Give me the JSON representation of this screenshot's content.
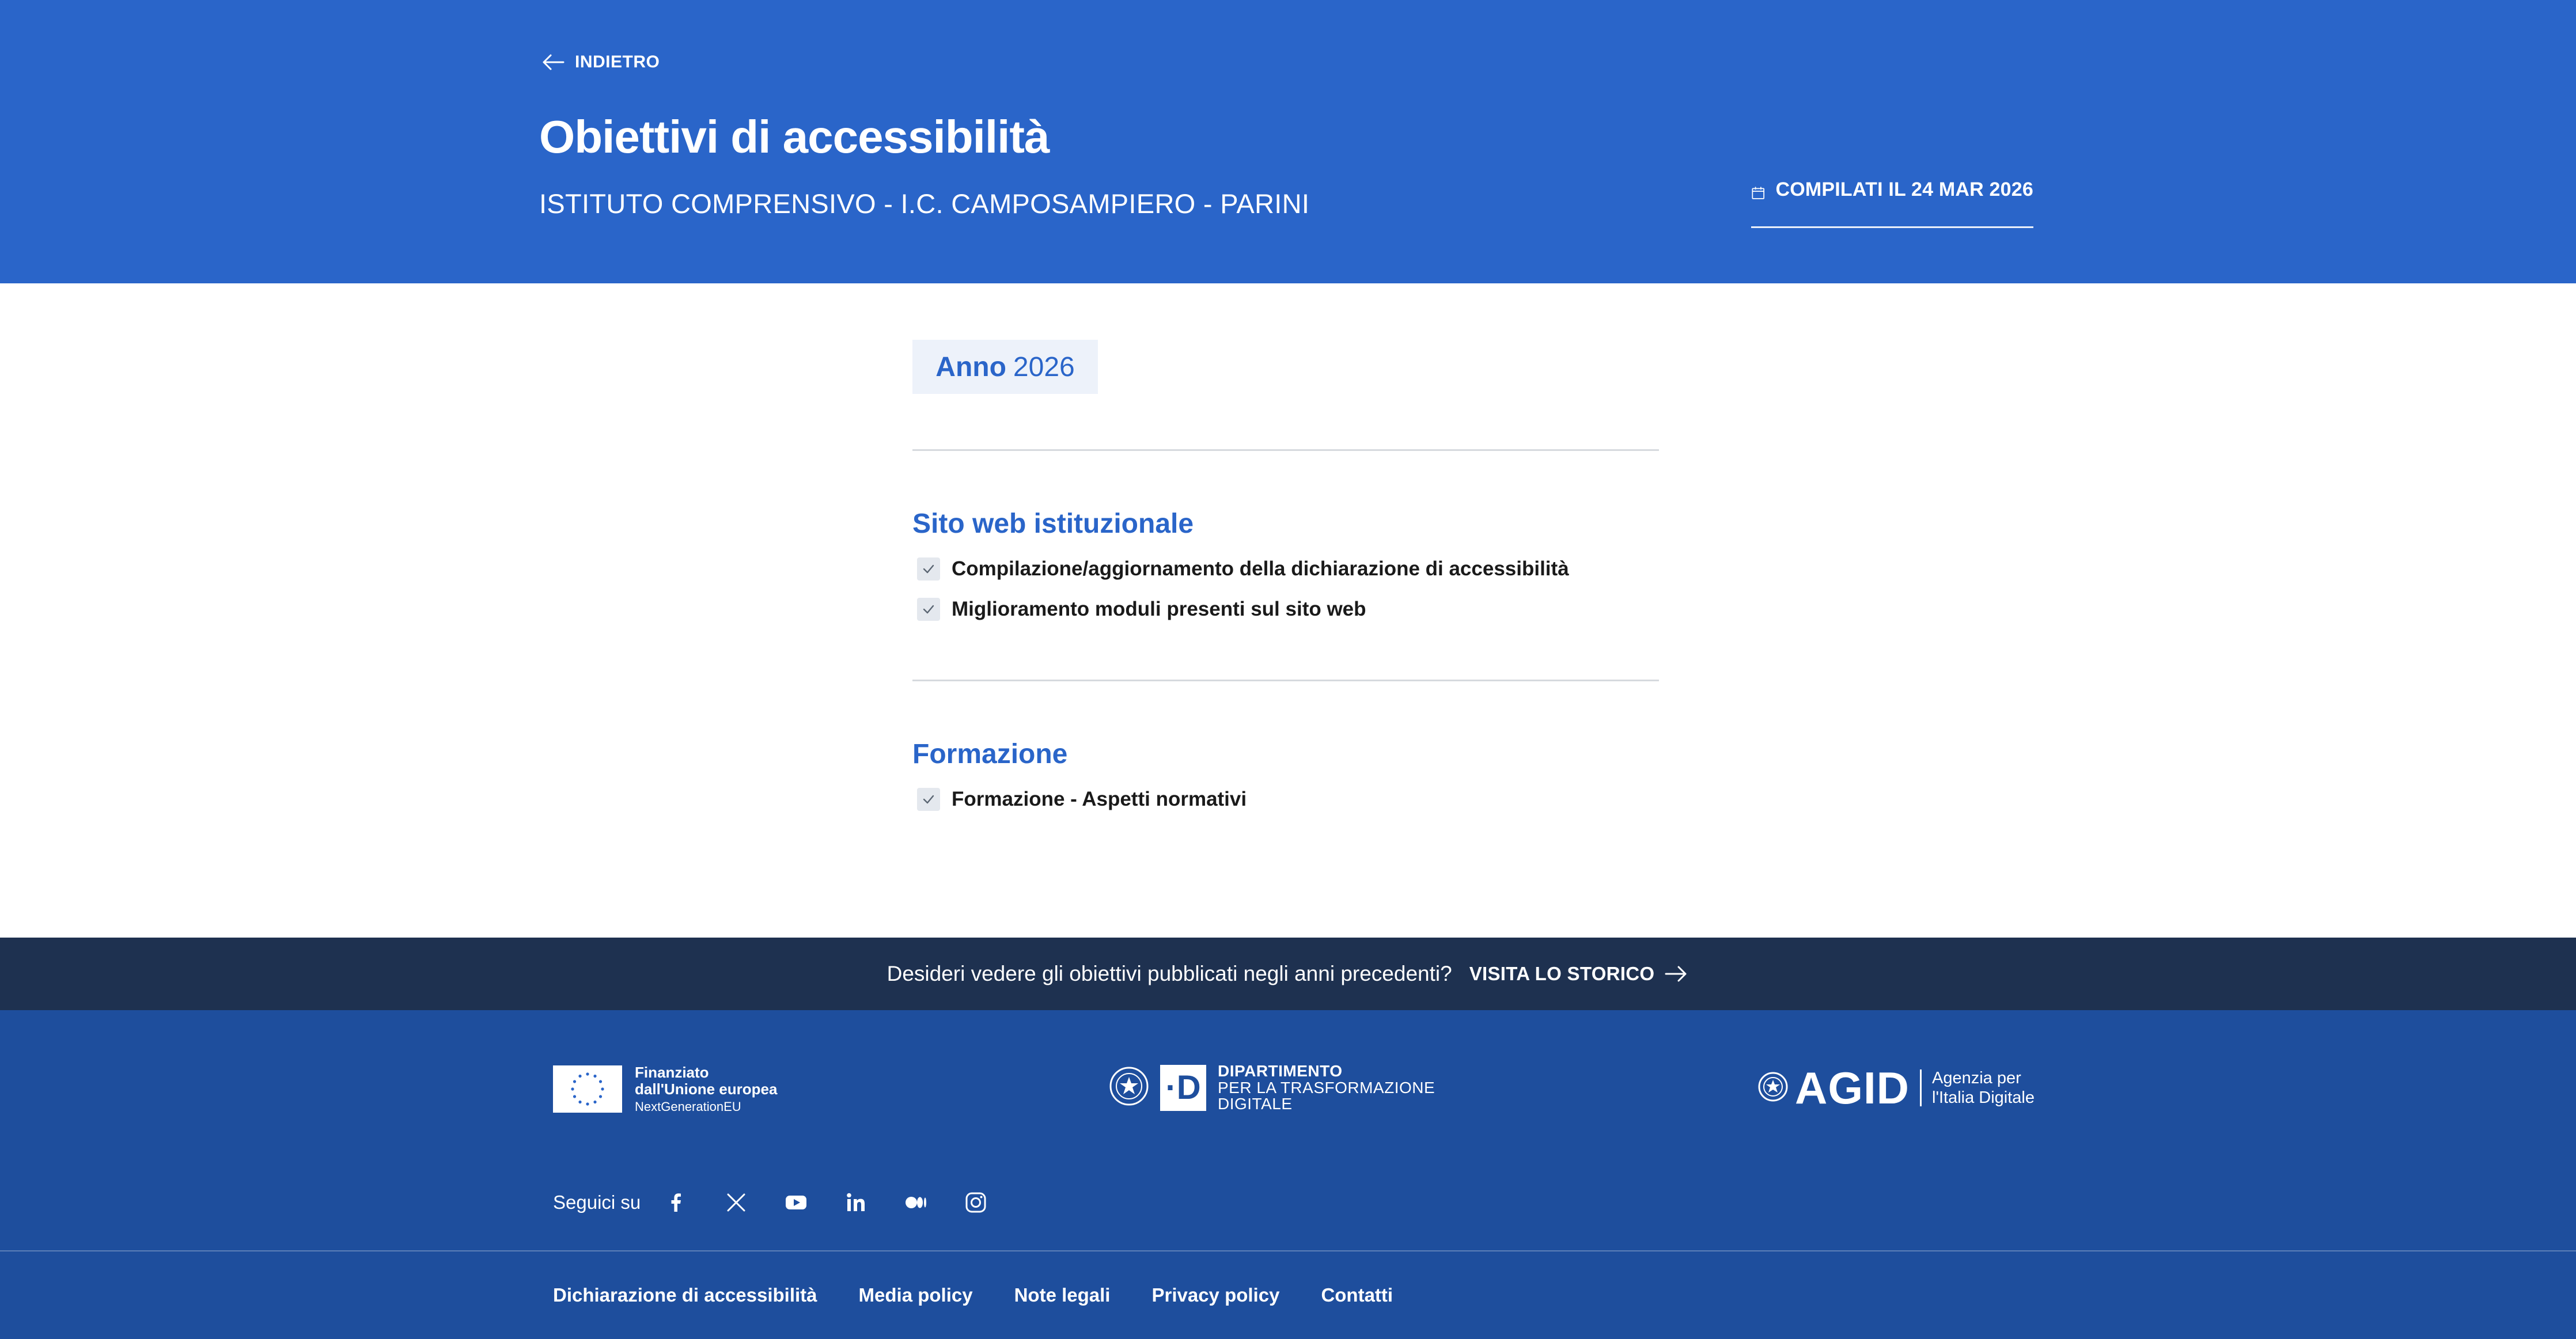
{
  "header": {
    "back_label": "INDIETRO",
    "title": "Obiettivi di accessibilità",
    "org_name": "ISTITUTO COMPRENSIVO - I.C. CAMPOSAMPIERO - PARINI",
    "compiled_text": "COMPILATI IL 24 MAR 2026",
    "compiled_icon": "calendar-icon"
  },
  "year_chip": {
    "label": "Anno",
    "year": "2026"
  },
  "sections": [
    {
      "title": "Sito web istituzionale",
      "items": [
        "Compilazione/aggiornamento della dichiarazione di accessibilità",
        "Miglioramento moduli presenti sul sito web"
      ]
    },
    {
      "title": "Formazione",
      "items": [
        "Formazione - Aspetti normativi"
      ]
    }
  ],
  "archive": {
    "question": "Desideri vedere gli obiettivi pubblicati negli anni precedenti?",
    "link_label": "VISITA LO STORICO",
    "link_icon": "arrow-right-icon"
  },
  "footer": {
    "eu": {
      "line1": "Finanziato",
      "line2": "dall'Unione europea",
      "line3": "NextGenerationEU"
    },
    "dtd": {
      "letter": "·D",
      "line1": "DIPARTIMENTO",
      "line2": "PER LA TRASFORMAZIONE",
      "line3": "DIGITALE"
    },
    "agid": {
      "word": "AGID",
      "line1": "Agenzia per",
      "line2": "l'Italia Digitale"
    },
    "social_label": "Seguici su",
    "social_icons": [
      "facebook-icon",
      "x-icon",
      "youtube-icon",
      "linkedin-icon",
      "medium-icon",
      "instagram-icon"
    ],
    "links": [
      "Dichiarazione di accessibilità",
      "Media policy",
      "Note legali",
      "Privacy policy",
      "Contatti"
    ]
  },
  "colors": {
    "primary": "#2a65c9",
    "archive_band": "#1e3150",
    "footer_bg": "#1e4e9d",
    "chip_bg": "#edf2fa",
    "check_bg": "#e4e8ee"
  }
}
